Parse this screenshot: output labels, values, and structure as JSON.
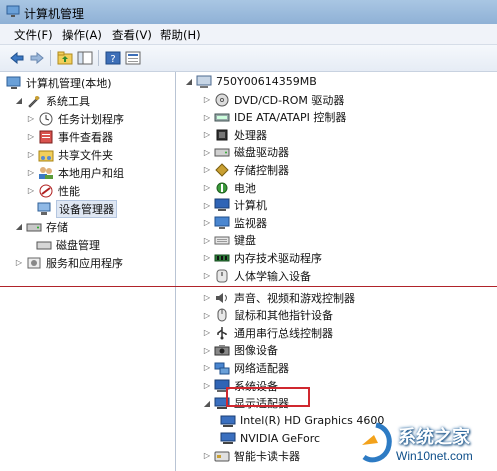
{
  "window": {
    "title": "计算机管理"
  },
  "menu": [
    "文件(F)",
    "操作(A)",
    "查看(V)",
    "帮助(H)"
  ],
  "toolbar": [
    "back-icon",
    "forward-icon",
    "up-folder-icon",
    "show-hide-tree-icon",
    "help-icon",
    "properties-icon"
  ],
  "left_tree": [
    {
      "label": "计算机管理(本地)",
      "icon": "computer-management-icon"
    },
    {
      "label": "系统工具",
      "icon": "tools-icon"
    },
    {
      "label": "任务计划程序",
      "icon": "clock-icon"
    },
    {
      "label": "事件查看器",
      "icon": "event-viewer-icon"
    },
    {
      "label": "共享文件夹",
      "icon": "shared-folder-icon"
    },
    {
      "label": "本地用户和组",
      "icon": "users-icon"
    },
    {
      "label": "性能",
      "icon": "performance-icon"
    },
    {
      "label": "设备管理器",
      "icon": "device-manager-icon"
    },
    {
      "label": "存储",
      "icon": "storage-icon"
    },
    {
      "label": "磁盘管理",
      "icon": "disk-icon"
    },
    {
      "label": "服务和应用程序",
      "icon": "services-icon"
    }
  ],
  "device_tree": {
    "root": "750Y00614359MB",
    "items": [
      {
        "label": "DVD/CD-ROM 驱动器",
        "icon": "dvd-icon"
      },
      {
        "label": "IDE ATA/ATAPI 控制器",
        "icon": "ide-icon"
      },
      {
        "label": "处理器",
        "icon": "cpu-icon"
      },
      {
        "label": "磁盘驱动器",
        "icon": "disk-drive-icon"
      },
      {
        "label": "存储控制器",
        "icon": "storage-controller-icon"
      },
      {
        "label": "电池",
        "icon": "battery-icon"
      },
      {
        "label": "计算机",
        "icon": "computer-icon"
      },
      {
        "label": "监视器",
        "icon": "monitor-icon"
      },
      {
        "label": "键盘",
        "icon": "keyboard-icon"
      },
      {
        "label": "内存技术驱动程序",
        "icon": "memory-icon"
      },
      {
        "label": "人体学输入设备",
        "icon": "hid-icon"
      },
      {
        "label": "声音、视频和游戏控制器",
        "icon": "sound-icon"
      },
      {
        "label": "鼠标和其他指针设备",
        "icon": "mouse-icon"
      },
      {
        "label": "通用串行总线控制器",
        "icon": "usb-icon"
      },
      {
        "label": "图像设备",
        "icon": "camera-icon"
      },
      {
        "label": "网络适配器",
        "icon": "network-icon"
      },
      {
        "label": "系统设备",
        "icon": "system-device-icon"
      },
      {
        "label": "显示适配器",
        "icon": "display-adapter-icon"
      },
      {
        "label": "Intel(R) HD Graphics 4600",
        "icon": "display-adapter-icon"
      },
      {
        "label": "NVIDIA GeForc",
        "icon": "display-adapter-icon"
      },
      {
        "label": "智能卡读卡器",
        "icon": "smartcard-icon"
      }
    ]
  },
  "watermark": {
    "title": "系统之家",
    "url": "Win10net.com"
  },
  "colors": {
    "highlight_box": "#d0282f",
    "divider_line": "#b0232a"
  }
}
